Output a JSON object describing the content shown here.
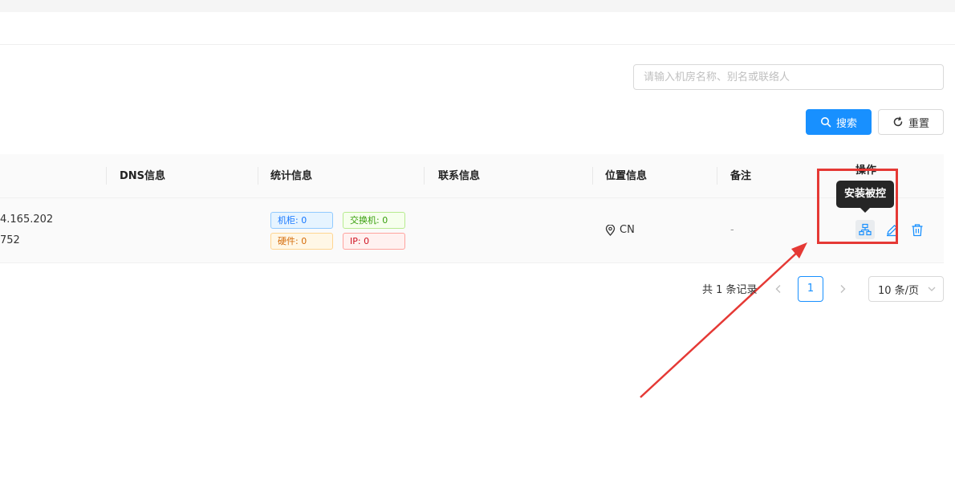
{
  "search": {
    "placeholder": "请输入机房名称、别名或联络人",
    "search_label": "搜索",
    "reset_label": "重置"
  },
  "table": {
    "headers": [
      "DNS信息",
      "统计信息",
      "联系信息",
      "位置信息",
      "备注",
      "操作"
    ],
    "row": {
      "ip_partial": "4.165.202",
      "id_partial": "752",
      "tags": {
        "cabinet": "机柜: 0",
        "switch": "交换机: 0",
        "hardware": "硬件: 0",
        "ip": "IP: 0"
      },
      "location": "CN",
      "remark": "-"
    }
  },
  "tooltip": {
    "text": "安装被控"
  },
  "pagination": {
    "total": "共 1 条记录",
    "current_page": "1",
    "page_size": "10 条/页"
  },
  "colors": {
    "primary": "#1890ff",
    "highlight_red": "#e53935",
    "tooltip_bg": "#262626"
  },
  "icons": {
    "search": "search-icon",
    "reset": "reload-icon",
    "location": "location-pin-icon",
    "install": "cluster-icon",
    "edit": "edit-icon",
    "delete": "trash-icon"
  }
}
